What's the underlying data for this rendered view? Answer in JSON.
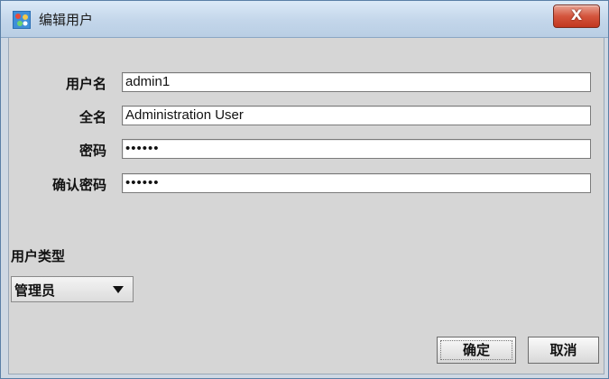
{
  "window": {
    "title": "编辑用户",
    "close_label": "X"
  },
  "form": {
    "fields": [
      {
        "label": "用户名",
        "value": "admin1"
      },
      {
        "label": "全名",
        "value": "Administration User"
      },
      {
        "label": "密码",
        "value": "••••••"
      },
      {
        "label": "确认密码",
        "value": "••••••"
      }
    ]
  },
  "user_type": {
    "label": "用户类型",
    "selected": "管理员"
  },
  "buttons": {
    "ok": "确定",
    "cancel": "取消"
  },
  "colors": {
    "titlebar": "#c3d6ea",
    "client_bg": "#d6d6d6",
    "close_button": "#d4553d"
  },
  "icons": {
    "app": "user-app-icon",
    "close": "close-icon",
    "dropdown": "chevron-down-icon"
  }
}
